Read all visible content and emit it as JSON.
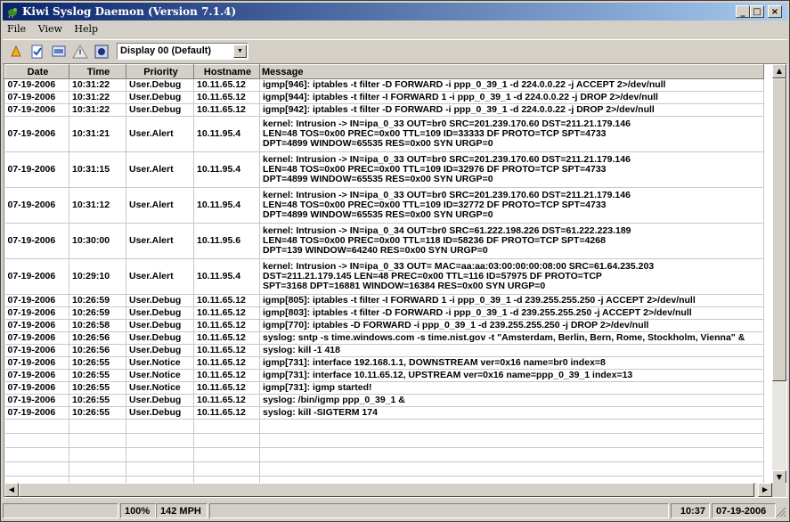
{
  "window": {
    "title": "Kiwi Syslog Daemon (Version 7.1.4)",
    "controls": {
      "minimize": "_",
      "maximize": "□",
      "close": "×"
    }
  },
  "menu": [
    "File",
    "View",
    "Help"
  ],
  "toolbar": {
    "icons": [
      "open-icon",
      "checklist-icon",
      "display-icon",
      "alert-icon",
      "picture-icon"
    ],
    "display_select": "Display 00 (Default)"
  },
  "grid": {
    "columns": [
      "Date",
      "Time",
      "Priority",
      "Hostname",
      "Message"
    ],
    "rows": [
      {
        "date": "07-19-2006",
        "time": "10:31:22",
        "priority": "User.Debug",
        "host": "10.11.65.12",
        "message": "igmp[946]: iptables -t filter -D FORWARD -i ppp_0_39_1 -d 224.0.0.22 -j ACCEPT 2>/dev/null"
      },
      {
        "date": "07-19-2006",
        "time": "10:31:22",
        "priority": "User.Debug",
        "host": "10.11.65.12",
        "message": "igmp[944]: iptables -t filter -I FORWARD 1 -i ppp_0_39_1 -d 224.0.0.22 -j DROP 2>/dev/null"
      },
      {
        "date": "07-19-2006",
        "time": "10:31:22",
        "priority": "User.Debug",
        "host": "10.11.65.12",
        "message": "igmp[942]: iptables -t filter -D FORWARD -i ppp_0_39_1 -d 224.0.0.22 -j DROP 2>/dev/null"
      },
      {
        "date": "07-19-2006",
        "time": "10:31:21",
        "priority": "User.Alert",
        "host": "10.11.95.4",
        "message": "kernel: Intrusion -> IN=ipa_0_33 OUT=br0 SRC=201.239.170.60 DST=211.21.179.146\nLEN=48 TOS=0x00 PREC=0x00 TTL=109 ID=33333 DF PROTO=TCP SPT=4733\nDPT=4899 WINDOW=65535 RES=0x00 SYN URGP=0"
      },
      {
        "date": "07-19-2006",
        "time": "10:31:15",
        "priority": "User.Alert",
        "host": "10.11.95.4",
        "message": "kernel: Intrusion -> IN=ipa_0_33 OUT=br0 SRC=201.239.170.60 DST=211.21.179.146\nLEN=48 TOS=0x00 PREC=0x00 TTL=109 ID=32976 DF PROTO=TCP SPT=4733\nDPT=4899 WINDOW=65535 RES=0x00 SYN URGP=0"
      },
      {
        "date": "07-19-2006",
        "time": "10:31:12",
        "priority": "User.Alert",
        "host": "10.11.95.4",
        "message": "kernel: Intrusion -> IN=ipa_0_33 OUT=br0 SRC=201.239.170.60 DST=211.21.179.146\nLEN=48 TOS=0x00 PREC=0x00 TTL=109 ID=32772 DF PROTO=TCP SPT=4733\nDPT=4899 WINDOW=65535 RES=0x00 SYN URGP=0"
      },
      {
        "date": "07-19-2006",
        "time": "10:30:00",
        "priority": "User.Alert",
        "host": "10.11.95.6",
        "message": "kernel: Intrusion -> IN=ipa_0_34 OUT=br0 SRC=61.222.198.226 DST=61.222.223.189\nLEN=48 TOS=0x00 PREC=0x00 TTL=118 ID=58236 DF PROTO=TCP SPT=4268\nDPT=139 WINDOW=64240 RES=0x00 SYN URGP=0"
      },
      {
        "date": "07-19-2006",
        "time": "10:29:10",
        "priority": "User.Alert",
        "host": "10.11.95.4",
        "message": "kernel: Intrusion -> IN=ipa_0_33 OUT= MAC=aa:aa:03:00:00:00:08:00 SRC=61.64.235.203\nDST=211.21.179.145 LEN=48 PREC=0x00 TTL=116 ID=57975 DF PROTO=TCP\nSPT=3168 DPT=16881 WINDOW=16384 RES=0x00 SYN URGP=0"
      },
      {
        "date": "07-19-2006",
        "time": "10:26:59",
        "priority": "User.Debug",
        "host": "10.11.65.12",
        "message": "igmp[805]: iptables -t filter -I FORWARD 1 -i ppp_0_39_1 -d 239.255.255.250 -j ACCEPT 2>/dev/null"
      },
      {
        "date": "07-19-2006",
        "time": "10:26:59",
        "priority": "User.Debug",
        "host": "10.11.65.12",
        "message": "igmp[803]: iptables -t filter -D FORWARD -i ppp_0_39_1 -d 239.255.255.250 -j ACCEPT 2>/dev/null"
      },
      {
        "date": "07-19-2006",
        "time": "10:26:58",
        "priority": "User.Debug",
        "host": "10.11.65.12",
        "message": "igmp[770]: iptables -D FORWARD -i ppp_0_39_1 -d 239.255.255.250 -j DROP 2>/dev/null"
      },
      {
        "date": "07-19-2006",
        "time": "10:26:56",
        "priority": "User.Debug",
        "host": "10.11.65.12",
        "message": "syslog: sntp -s time.windows.com -s time.nist.gov -t \"Amsterdam, Berlin, Bern, Rome, Stockholm, Vienna\" &"
      },
      {
        "date": "07-19-2006",
        "time": "10:26:56",
        "priority": "User.Debug",
        "host": "10.11.65.12",
        "message": "syslog: kill -1 418"
      },
      {
        "date": "07-19-2006",
        "time": "10:26:55",
        "priority": "User.Notice",
        "host": "10.11.65.12",
        "message": "igmp[731]:  interface 192.168.1.1, DOWNSTREAM ver=0x16 name=br0 index=8"
      },
      {
        "date": "07-19-2006",
        "time": "10:26:55",
        "priority": "User.Notice",
        "host": "10.11.65.12",
        "message": "igmp[731]:  interface 10.11.65.12, UPSTREAM ver=0x16 name=ppp_0_39_1 index=13"
      },
      {
        "date": "07-19-2006",
        "time": "10:26:55",
        "priority": "User.Notice",
        "host": "10.11.65.12",
        "message": "igmp[731]:  igmp started!"
      },
      {
        "date": "07-19-2006",
        "time": "10:26:55",
        "priority": "User.Debug",
        "host": "10.11.65.12",
        "message": "syslog: /bin/igmp ppp_0_39_1  &"
      },
      {
        "date": "07-19-2006",
        "time": "10:26:55",
        "priority": "User.Debug",
        "host": "10.11.65.12",
        "message": "syslog: kill -SIGTERM 174"
      }
    ]
  },
  "statusbar": {
    "percent": "100%",
    "rate": "142 MPH",
    "time": "10:37",
    "date": "07-19-2006"
  }
}
